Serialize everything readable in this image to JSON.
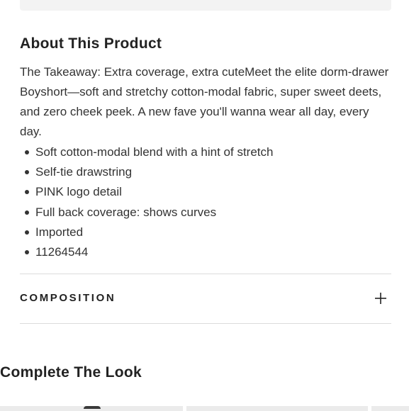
{
  "about": {
    "heading": "About This Product",
    "description": "The Takeaway: Extra coverage, extra cuteMeet the elite dorm-drawer Boyshort—soft and stretchy cotton-modal fabric, super sweet deets, and zero cheek peek. A new fave you'll wanna wear all day, every day.",
    "bullets": [
      "Soft cotton-modal blend with a hint of stretch",
      "Self-tie drawstring",
      "PINK logo detail",
      "Full back coverage: shows curves",
      "Imported",
      "11264544"
    ]
  },
  "composition": {
    "label": "COMPOSITION",
    "toggle_icon": "plus-icon",
    "expanded": false
  },
  "complete_the_look": {
    "heading": "Complete The Look"
  }
}
